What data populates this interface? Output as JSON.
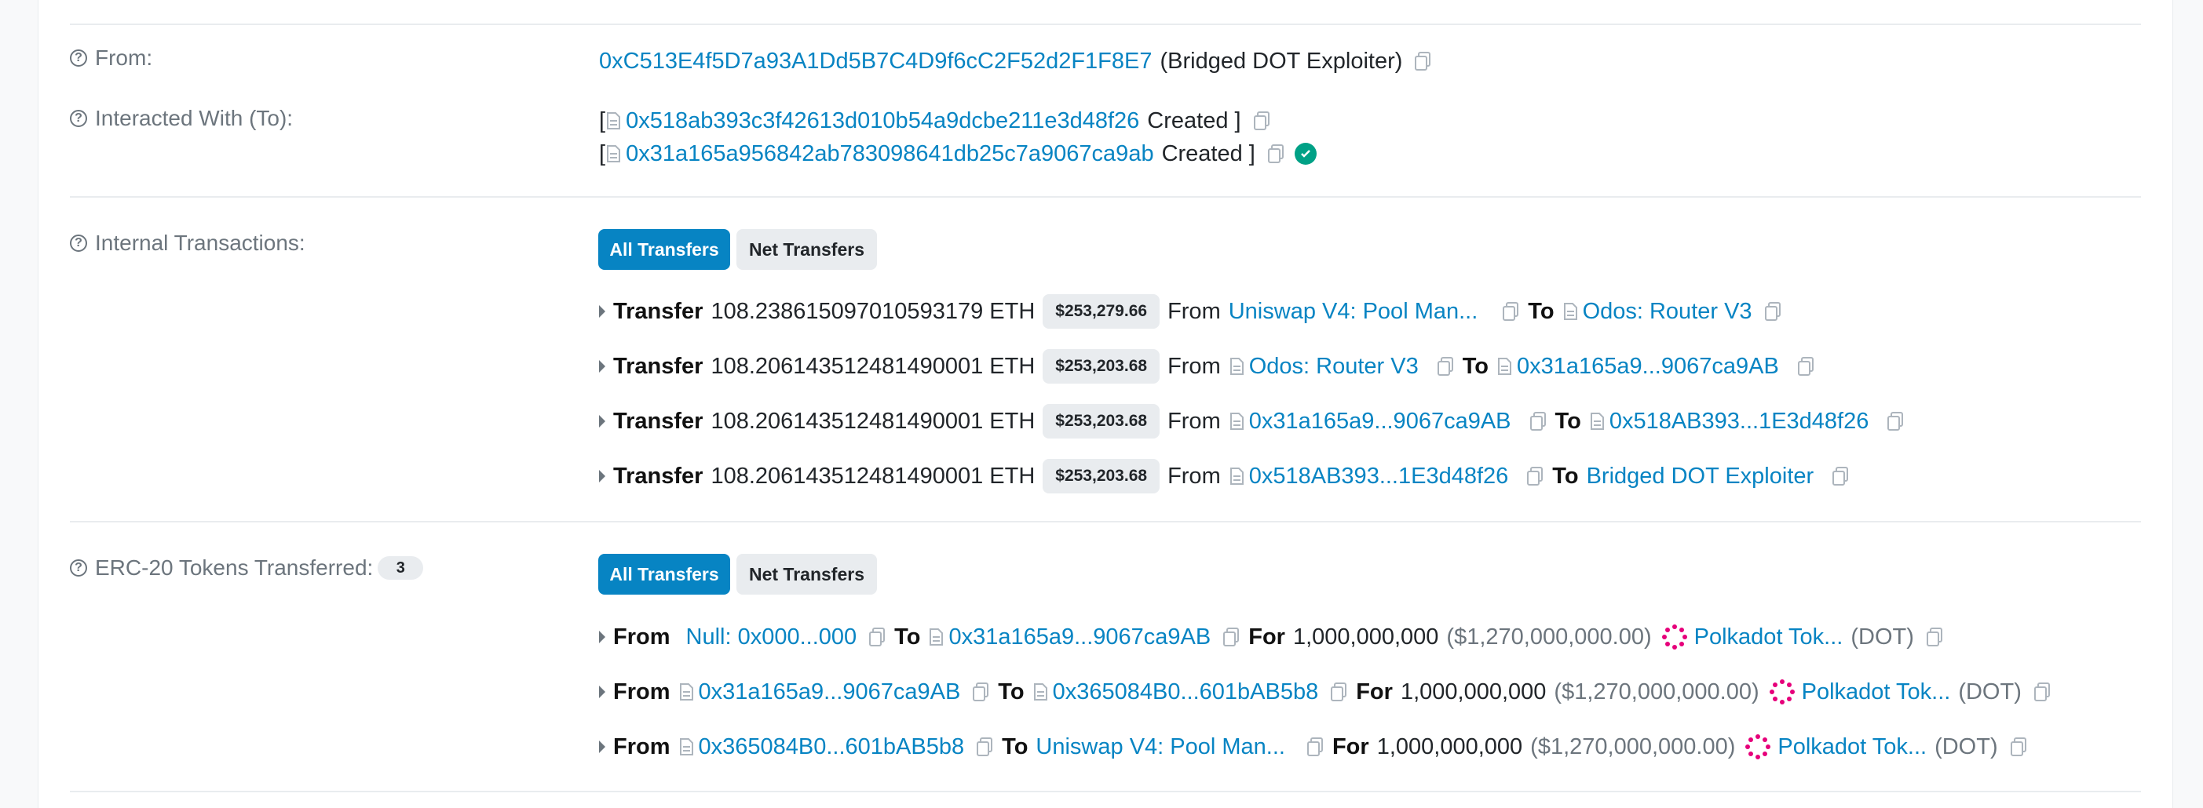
{
  "labels": {
    "from": "From:",
    "interacted": "Interacted With (To):",
    "internal": "Internal Transactions:",
    "erc20": "ERC-20 Tokens Transferred:",
    "erc20_count": "3"
  },
  "from": {
    "address": "0xC513E4f5D7a93A1Dd5B7C4D9f6cC2F52d2F1F8E7",
    "name": "(Bridged DOT Exploiter)"
  },
  "interacted": [
    {
      "open": "[",
      "address": "0x518ab393c3f42613d010b54a9dcbe211e3d48f26",
      "status": "Created ]"
    },
    {
      "open": "[",
      "address": "0x31a165a956842ab783098641db25c7a9067ca9ab",
      "status": "Created ]"
    }
  ],
  "buttons": {
    "all": "All Transfers",
    "net": "Net Transfers"
  },
  "words": {
    "transfer": "Transfer",
    "from": "From",
    "to": "To",
    "for": "For"
  },
  "internal": [
    {
      "amount": "108.238615097010593179 ETH",
      "usd": "$253,279.66",
      "from": "Uniswap V4: Pool Man...",
      "to": "Odos: Router V3"
    },
    {
      "amount": "108.206143512481490001 ETH",
      "usd": "$253,203.68",
      "from": "Odos: Router V3",
      "to": "0x31a165a9...9067ca9AB"
    },
    {
      "amount": "108.206143512481490001 ETH",
      "usd": "$253,203.68",
      "from": "0x31a165a9...9067ca9AB",
      "to": "0x518AB393...1E3d48f26"
    },
    {
      "amount": "108.206143512481490001 ETH",
      "usd": "$253,203.68",
      "from": "0x518AB393...1E3d48f26",
      "to": "Bridged DOT Exploiter"
    }
  ],
  "erc20": [
    {
      "from": "Null: 0x000...000",
      "to": "0x31a165a9...9067ca9AB",
      "amount": "1,000,000,000",
      "usd": "($1,270,000,000.00)",
      "token": "Polkadot Tok...",
      "symbol": "(DOT)"
    },
    {
      "from": "0x31a165a9...9067ca9AB",
      "to": "0x365084B0...601bAB5b8",
      "amount": "1,000,000,000",
      "usd": "($1,270,000,000.00)",
      "token": "Polkadot Tok...",
      "symbol": "(DOT)"
    },
    {
      "from": "0x365084B0...601bAB5b8",
      "to": "Uniswap V4: Pool Man...",
      "amount": "1,000,000,000",
      "usd": "($1,270,000,000.00)",
      "token": "Polkadot Tok...",
      "symbol": "(DOT)"
    }
  ],
  "colors": {
    "link": "#0784c3",
    "button_active": "#0784c3",
    "verified": "#00a186",
    "polkadot": "#e6007a"
  },
  "icons": [
    "question-circle-icon",
    "copy-icon",
    "contract-doc-icon",
    "verified-check-icon",
    "caret-right-icon",
    "polkadot-token-icon"
  ]
}
